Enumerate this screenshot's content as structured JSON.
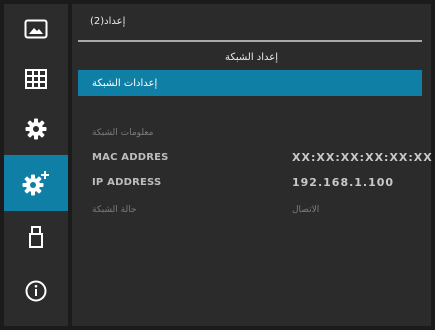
{
  "header": {
    "title": "إعداد(2)"
  },
  "section": {
    "title": "إعداد الشبكة"
  },
  "menu": {
    "selected_item": "إعدادات الشبكة"
  },
  "network_info": {
    "section_label": "معلومات الشبكة",
    "mac_label": "MAC ADDRES",
    "mac_value": "XX:XX:XX:XX:XX:XX",
    "ip_label": "IP ADDRESS",
    "ip_value": "192.168.1.100",
    "status_label": "حالة الشبكة",
    "status_value": "الاتصال"
  },
  "sidebar": {
    "items": [
      {
        "icon": "picture-icon"
      },
      {
        "icon": "grid-icon"
      },
      {
        "icon": "gear-icon"
      },
      {
        "icon": "gear-plus-icon",
        "active": true
      },
      {
        "icon": "usb-icon"
      },
      {
        "icon": "info-icon"
      }
    ]
  },
  "colors": {
    "accent": "#0f7fa6",
    "sidebar_bg": "#2c2c2c",
    "content_bg": "#2b2b2b"
  }
}
